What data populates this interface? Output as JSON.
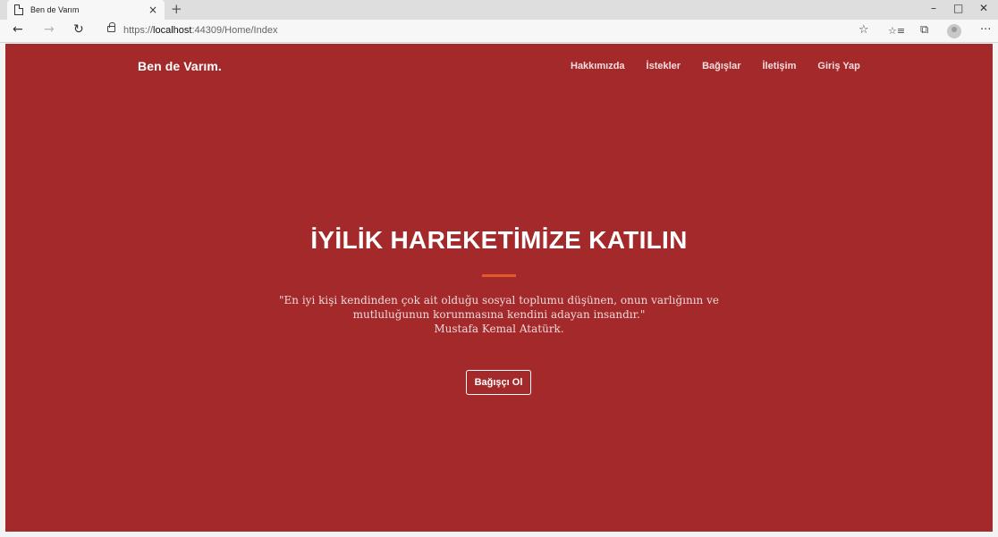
{
  "browser": {
    "tab_title": "Ben de Varım",
    "tab_close": "×",
    "new_tab": "+",
    "url_prefix": "https://",
    "url_host": "localhost",
    "url_rest": ":44309/Home/Index",
    "window_controls": {
      "minimize": "–",
      "maximize": "□",
      "close": "✕"
    },
    "nav": {
      "back": "←",
      "forward": "→",
      "refresh": "↻"
    },
    "tools": {
      "favorite": "☆",
      "collections": "☆≡",
      "extensions": "⧉",
      "more": "···"
    }
  },
  "site": {
    "brand": "Ben de Varım.",
    "nav_items": [
      "Hakkımızda",
      "İstekler",
      "Bağışlar",
      "İletişim",
      "Giriş Yap"
    ],
    "hero_title": "İYİLİK HAREKETİMİZE KATILIN",
    "quote_line1": "\"En iyi kişi kendinden çok ait olduğu sosyal toplumu düşünen, onun varlığının ve",
    "quote_line2": "mutluluğunun korunmasına kendini adayan insandır.\"",
    "quote_author": "Mustafa Kemal Atatürk.",
    "cta_label": "Bağışçı Ol"
  },
  "colors": {
    "page_background": "#a4292b",
    "accent_divider": "#e3582d",
    "text_light": "#ffffff"
  }
}
